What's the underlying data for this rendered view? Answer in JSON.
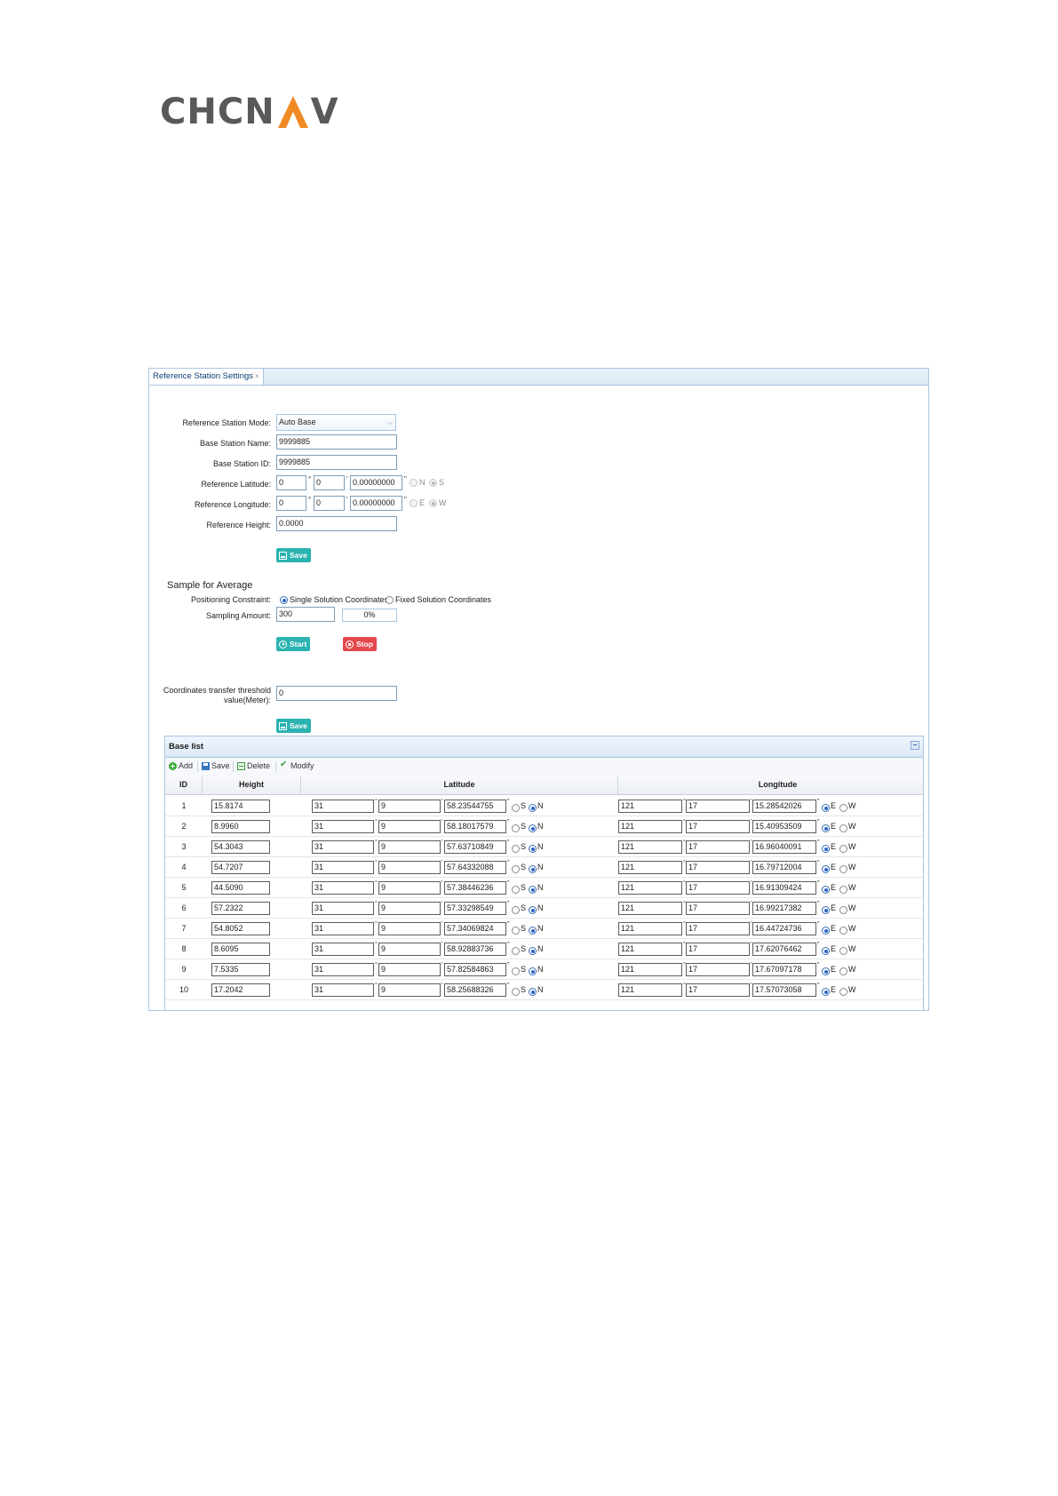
{
  "logo": {
    "left": "CHCN",
    "right": "V"
  },
  "tab": {
    "label": "Reference Station Settings",
    "close": "×"
  },
  "form": {
    "mode_label": "Reference Station Mode:",
    "mode_value": "Auto Base",
    "name_label": "Base Station Name:",
    "name_value": "9999885",
    "id_label": "Base Station ID:",
    "id_value": "9999885",
    "lat_label": "Reference Latitude:",
    "lat_deg": "0",
    "lat_min": "0",
    "lat_sec": "0.00000000",
    "lat_n": "N",
    "lat_s": "S",
    "lon_label": "Reference Longitude:",
    "lon_deg": "0",
    "lon_min": "0",
    "lon_sec": "0.00000000",
    "lon_e": "E",
    "lon_w": "W",
    "height_label": "Reference Height:",
    "height_value": "0.0000",
    "save_label": "Save"
  },
  "average": {
    "title": "Sample for Average",
    "constraint_label": "Positioning Constraint:",
    "opt_single": "Single Solution Coordinates",
    "opt_fixed": "Fixed Solution Coordinates",
    "amount_label": "Sampling Amount:",
    "amount_value": "300",
    "progress": "0%",
    "start_label": "Start",
    "stop_label": "Stop"
  },
  "threshold": {
    "label_line1": "Coordinates transfer threshold",
    "label_line2": "value(Meter):",
    "value": "0",
    "save_label": "Save"
  },
  "base_list": {
    "title": "Base list",
    "toolbar": {
      "add": "Add",
      "save": "Save",
      "delete": "Delete",
      "modify": "Modify"
    },
    "columns": {
      "id": "ID",
      "height": "Height",
      "latitude": "Latitude",
      "longitude": "Longitude"
    },
    "radio_labels": {
      "s": "S",
      "n": "N",
      "e": "E",
      "w": "W"
    },
    "rows": [
      {
        "id": "1",
        "height": "15.8174",
        "lat_d": "31",
        "lat_m": "9",
        "lat_s": "58.23544755",
        "lon_d": "121",
        "lon_m": "17",
        "lon_s": "15.28542026"
      },
      {
        "id": "2",
        "height": "8.9960",
        "lat_d": "31",
        "lat_m": "9",
        "lat_s": "58.18017579",
        "lon_d": "121",
        "lon_m": "17",
        "lon_s": "15.40953509"
      },
      {
        "id": "3",
        "height": "54.3043",
        "lat_d": "31",
        "lat_m": "9",
        "lat_s": "57.63710849",
        "lon_d": "121",
        "lon_m": "17",
        "lon_s": "16.96040091"
      },
      {
        "id": "4",
        "height": "54.7207",
        "lat_d": "31",
        "lat_m": "9",
        "lat_s": "57.64332088",
        "lon_d": "121",
        "lon_m": "17",
        "lon_s": "16.79712004"
      },
      {
        "id": "5",
        "height": "44.5090",
        "lat_d": "31",
        "lat_m": "9",
        "lat_s": "57.38446236",
        "lon_d": "121",
        "lon_m": "17",
        "lon_s": "16.91309424"
      },
      {
        "id": "6",
        "height": "57.2322",
        "lat_d": "31",
        "lat_m": "9",
        "lat_s": "57.33298549",
        "lon_d": "121",
        "lon_m": "17",
        "lon_s": "16.99217382"
      },
      {
        "id": "7",
        "height": "54.8052",
        "lat_d": "31",
        "lat_m": "9",
        "lat_s": "57.34069824",
        "lon_d": "121",
        "lon_m": "17",
        "lon_s": "16.44724736"
      },
      {
        "id": "8",
        "height": "8.6095",
        "lat_d": "31",
        "lat_m": "9",
        "lat_s": "58.92883736",
        "lon_d": "121",
        "lon_m": "17",
        "lon_s": "17.62076462"
      },
      {
        "id": "9",
        "height": "7.5335",
        "lat_d": "31",
        "lat_m": "9",
        "lat_s": "57.82584863",
        "lon_d": "121",
        "lon_m": "17",
        "lon_s": "17.67097178"
      },
      {
        "id": "10",
        "height": "17.2042",
        "lat_d": "31",
        "lat_m": "9",
        "lat_s": "58.25688326",
        "lon_d": "121",
        "lon_m": "17",
        "lon_s": "17.57073058"
      }
    ]
  },
  "colors": {
    "teal": "#2bb3b0",
    "red": "#e4484d",
    "logo_gray": "#58595b",
    "logo_orange": "#f08a24"
  }
}
